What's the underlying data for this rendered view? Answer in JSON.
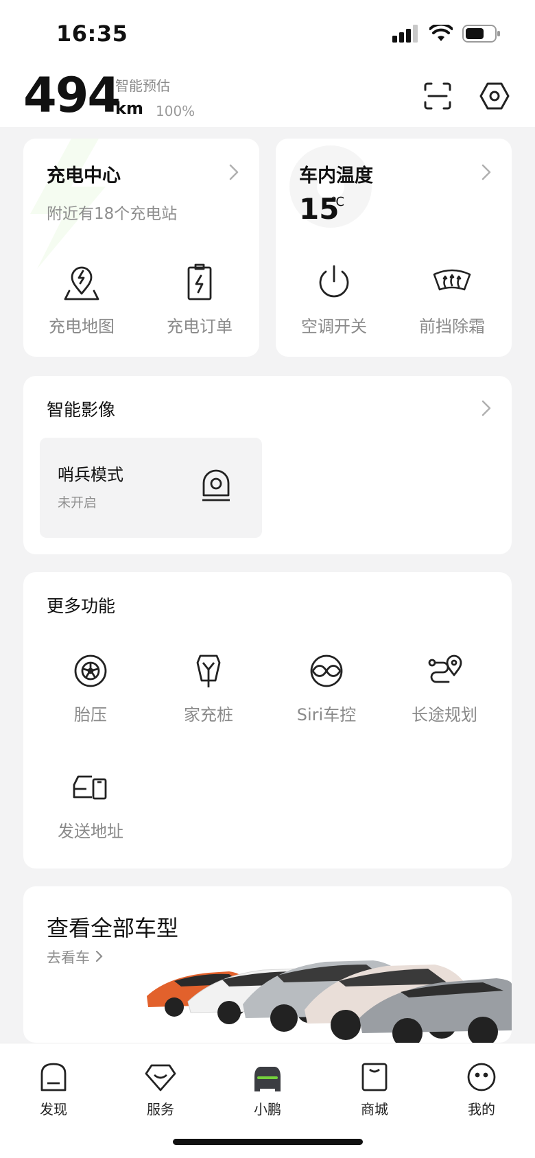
{
  "status": {
    "time": "16:35"
  },
  "range": {
    "value": "494",
    "unit": "km",
    "estimate_label": "智能预估",
    "battery_pct": "100%"
  },
  "charging": {
    "title": "充电中心",
    "subtitle": "附近有18个充电站",
    "map_label": "充电地图",
    "orders_label": "充电订单"
  },
  "climate": {
    "title": "车内温度",
    "temp": "15",
    "unit": "℃",
    "ac_label": "空调开关",
    "defrost_label": "前挡除霜"
  },
  "imaging": {
    "title": "智能影像",
    "sentry_title": "哨兵模式",
    "sentry_status": "未开启"
  },
  "more": {
    "title": "更多功能",
    "items": [
      {
        "label": "胎压",
        "icon": "tire-icon"
      },
      {
        "label": "家充桩",
        "icon": "home-charger-icon"
      },
      {
        "label": "Siri车控",
        "icon": "siri-icon"
      },
      {
        "label": "长途规划",
        "icon": "route-icon"
      },
      {
        "label": "发送地址",
        "icon": "send-address-icon"
      }
    ]
  },
  "models": {
    "title": "查看全部车型",
    "link": "去看车"
  },
  "tabs": [
    {
      "label": "发现",
      "icon": "discover-icon"
    },
    {
      "label": "服务",
      "icon": "service-icon"
    },
    {
      "label": "小鹏",
      "icon": "car-icon"
    },
    {
      "label": "商城",
      "icon": "mall-icon"
    },
    {
      "label": "我的",
      "icon": "profile-icon"
    }
  ],
  "colors": {
    "accent": "#74d13c",
    "card": "#ffffff",
    "background": "#f3f3f4"
  }
}
